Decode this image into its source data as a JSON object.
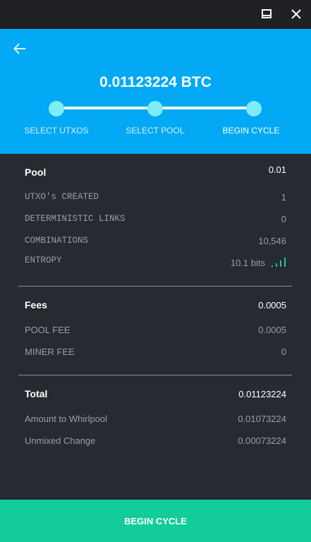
{
  "window": {
    "maximize_icon": "maximize-icon",
    "close_icon": "close-icon"
  },
  "header": {
    "back_icon": "arrow-left-icon",
    "amount": "0.01123224 BTC",
    "steps": [
      {
        "label": "SELECT UTXOS"
      },
      {
        "label": "SELECT POOL"
      },
      {
        "label": "BEGIN CYCLE"
      }
    ]
  },
  "pool": {
    "label": "Pool",
    "value": "0.01",
    "rows": [
      {
        "label": "UTXO's CREATED",
        "value": "1"
      },
      {
        "label": "DETERMINISTIC LINKS",
        "value": "0"
      },
      {
        "label": "COMBINATIONS",
        "value": "10,546"
      },
      {
        "label": "ENTROPY",
        "value": "10.1 bits"
      }
    ],
    "entropy_icon": "signal-bars-icon"
  },
  "fees": {
    "label": "Fees",
    "value": "0.0005",
    "rows": [
      {
        "label": "POOL FEE",
        "value": "0.0005"
      },
      {
        "label": "MINER FEE",
        "value": "0"
      }
    ]
  },
  "total": {
    "label": "Total",
    "value": "0.01123224",
    "rows": [
      {
        "label": "Amount to Whirlpool",
        "value": "0.01073224"
      },
      {
        "label": "Unmixed Change",
        "value": "0.00073224"
      }
    ]
  },
  "footer": {
    "button_label": "BEGIN CYCLE"
  },
  "colors": {
    "header_blue": "#03a9f4",
    "step_dot": "#80ecf5",
    "background": "#272a30",
    "button_green": "#14cc9a"
  }
}
